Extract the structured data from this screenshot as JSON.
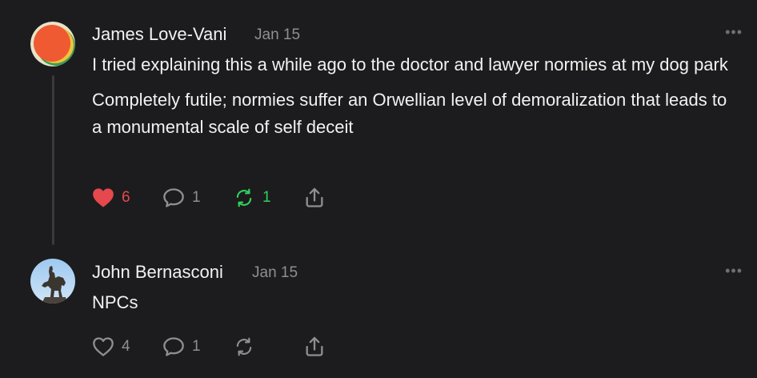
{
  "comments": [
    {
      "author": "James Love-Vani",
      "date": "Jan 15",
      "more": "•••",
      "paragraphs": [
        "I tried explaining this a while ago to the doctor and lawyer normies at my dog park",
        "Completely futile; normies suffer an Orwellian level of demoralization that leads to a monumental scale of self deceit"
      ],
      "likes": "6",
      "replies": "1",
      "reposts": "1",
      "liked": true,
      "reposted": true,
      "avatar_icon": "orange-circle-avatar"
    },
    {
      "author": "John Bernasconi",
      "date": "Jan 15",
      "more": "•••",
      "paragraphs": [
        "NPCs"
      ],
      "likes": "4",
      "replies": "1",
      "reposts": "",
      "liked": false,
      "reposted": false,
      "avatar_icon": "equestrian-statue-avatar"
    }
  ],
  "colors": {
    "background": "#1c1c1e",
    "like_active": "#e5484d",
    "repost_active": "#30d158",
    "muted": "#8e8e93"
  }
}
